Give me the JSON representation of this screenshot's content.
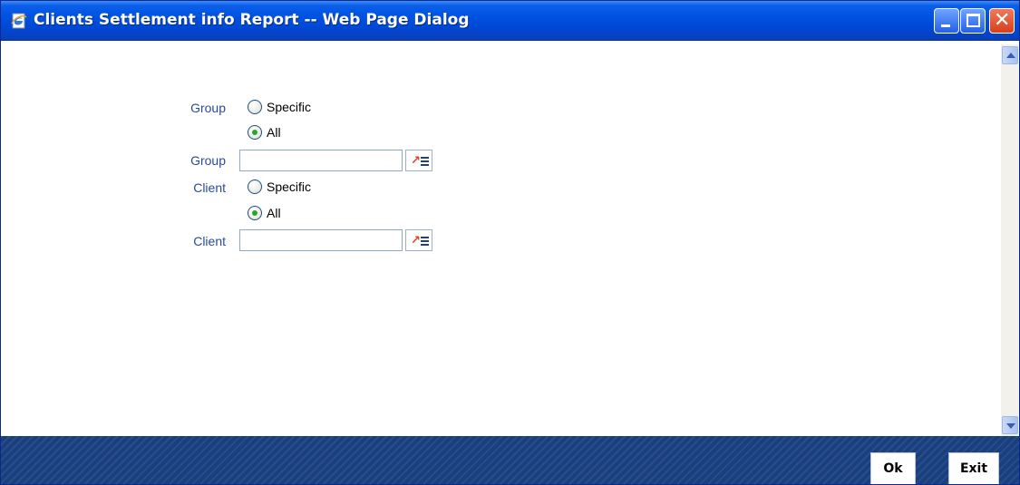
{
  "window": {
    "title": "Clients Settlement info Report -- Web Page Dialog"
  },
  "form": {
    "group_radio_label": "Group",
    "group_specific_label": "Specific",
    "group_all_label": "All",
    "group_selected": "All",
    "group_field_label": "Group",
    "group_value": "",
    "client_radio_label": "Client",
    "client_specific_label": "Specific",
    "client_all_label": "All",
    "client_selected": "All",
    "client_field_label": "Client",
    "client_value": ""
  },
  "footer": {
    "ok_label": "Ok",
    "exit_label": "Exit"
  },
  "colors": {
    "titlebar": "#0052e0",
    "label": "#2a4a9a",
    "footer": "#1a3f7e",
    "radio_dot": "#2aa52a",
    "lov_arrow": "#e8401c"
  }
}
